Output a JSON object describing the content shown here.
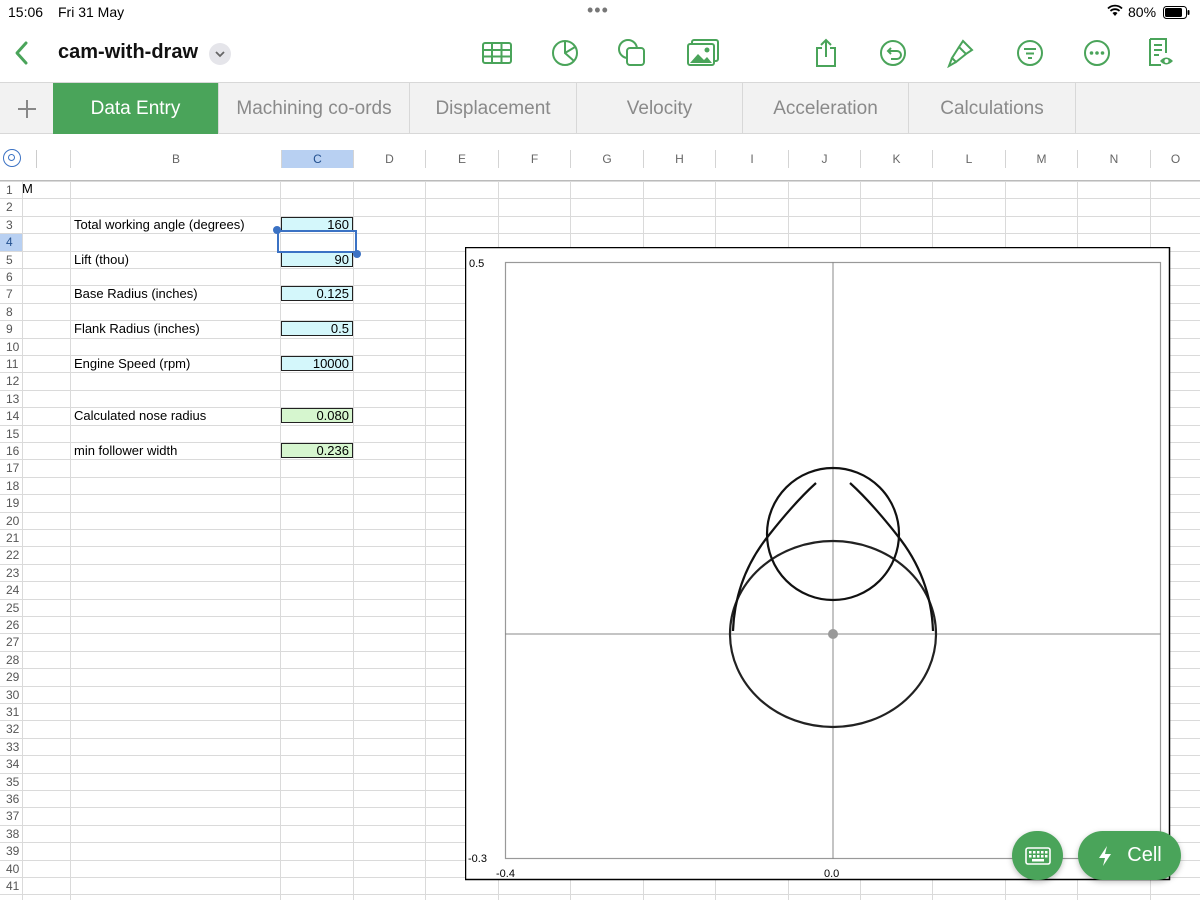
{
  "status": {
    "time": "15:06",
    "date": "Fri 31 May",
    "battery": "80%"
  },
  "toolbar": {
    "title": "cam-with-draw",
    "icons": [
      "back-icon",
      "table-icon",
      "chart-icon",
      "shape-icon",
      "media-icon",
      "share-icon",
      "undo-icon",
      "format-brush-icon",
      "organize-icon",
      "more-icon",
      "reading-view-icon"
    ]
  },
  "tabs": [
    "Data Entry",
    "Machining co-ords",
    "Displacement",
    "Velocity",
    "Acceleration",
    "Calculations"
  ],
  "columns": [
    "B",
    "C",
    "D",
    "E",
    "F",
    "G",
    "H",
    "I",
    "J",
    "K",
    "L",
    "M",
    "N",
    "O"
  ],
  "rows": [
    "1",
    "2",
    "3",
    "4",
    "5",
    "6",
    "7",
    "8",
    "9",
    "10",
    "11",
    "12",
    "13",
    "14",
    "15",
    "16",
    "17",
    "18",
    "19",
    "20",
    "21",
    "22",
    "23",
    "24",
    "25",
    "26",
    "27",
    "28",
    "29",
    "30",
    "31",
    "32",
    "33",
    "34",
    "35",
    "36",
    "37",
    "38",
    "39",
    "40",
    "41"
  ],
  "corner_text": "M",
  "inputs": [
    {
      "row": 3,
      "label": "Total working angle (degrees)",
      "value": "160",
      "kind": "input"
    },
    {
      "row": 5,
      "label": "Lift (thou)",
      "value": "90",
      "kind": "input"
    },
    {
      "row": 7,
      "label": "Base Radius (inches)",
      "value": "0.125",
      "kind": "input"
    },
    {
      "row": 9,
      "label": "Flank Radius (inches)",
      "value": "0.5",
      "kind": "input"
    },
    {
      "row": 11,
      "label": "Engine Speed (rpm)",
      "value": "10000",
      "kind": "input"
    },
    {
      "row": 14,
      "label": "Calculated nose radius",
      "value": "0.080",
      "kind": "calc"
    },
    {
      "row": 16,
      "label": "min follower width",
      "value": "0.236",
      "kind": "calc"
    }
  ],
  "selected_cell": {
    "column": "C",
    "row": "4"
  },
  "chart": {
    "y_top_label": "0.5",
    "y_bottom_label": "-0.3",
    "x_left_label": "-0.4",
    "x_center_label": "0.0"
  },
  "buttons": {
    "cell": "Cell"
  },
  "colors": {
    "accent": "#4aa45a",
    "input_fill": "#d4f7fb",
    "calc_fill": "#d6f6cf",
    "selection": "#3b72c4"
  }
}
